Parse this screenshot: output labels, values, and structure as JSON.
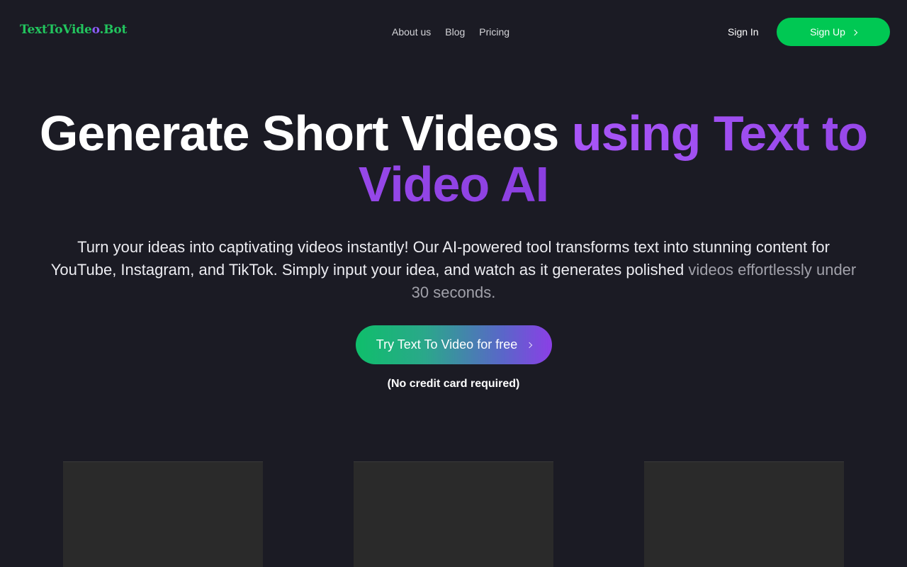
{
  "header": {
    "logo_main": "TextToVide",
    "logo_o": "o",
    "logo_tail": ".Bot",
    "nav": [
      "About us",
      "Blog",
      "Pricing"
    ],
    "signin_label": "Sign In",
    "signup_label": "Sign Up"
  },
  "hero": {
    "title_plain": "Generate Short Videos ",
    "title_accent": "using Text to Video AI",
    "subtitle_main": "Turn your ideas into captivating videos instantly! Our AI-powered tool transforms text into stunning content for YouTube, Instagram, and TikTok. Simply input your idea, and watch as it generates polished ",
    "subtitle_faded": "videos effortlessly under 30 seconds.",
    "cta_label": "Try Text To Video for free",
    "note": "(No credit card required)"
  },
  "colors": {
    "background": "#1b1b24",
    "brand_green": "#00c853",
    "accent_purple": "#9f4ff0"
  },
  "icons": {
    "signup_arrow": "chevron-right-icon",
    "cta_arrow": "chevron-right-icon"
  },
  "cards_count_visible": 3
}
